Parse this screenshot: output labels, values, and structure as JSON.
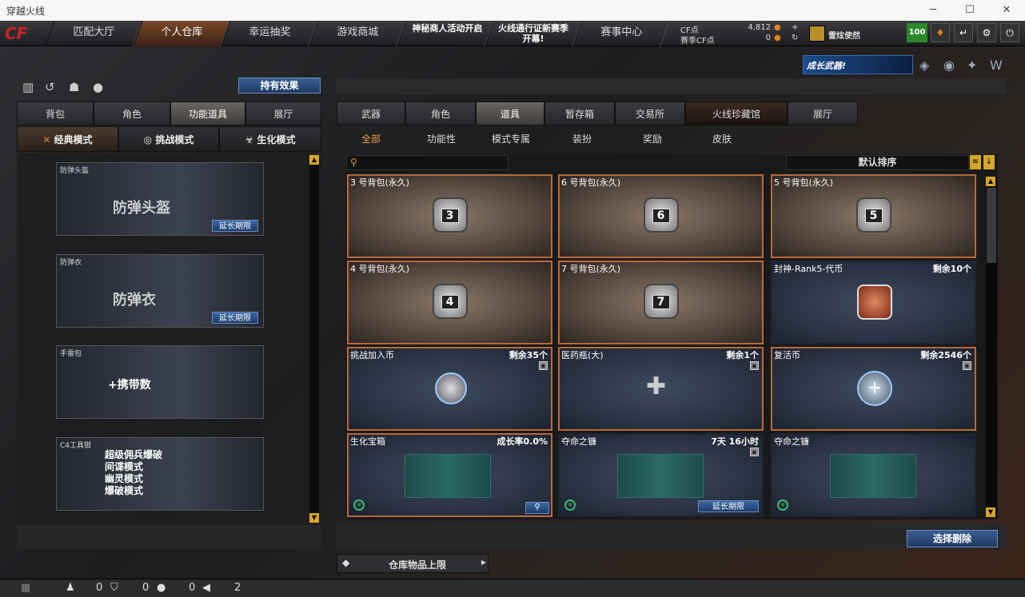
{
  "window": {
    "title": "穿越火线",
    "min": "─",
    "max": "☐",
    "close": "✕"
  },
  "nav": {
    "tabs": [
      "匹配大厅",
      "个人仓库",
      "幸运抽奖",
      "游戏商城",
      "神秘商人活动开启",
      "火线通行证新赛季开幕!",
      "赛事中心"
    ],
    "active": 1
  },
  "currency": {
    "cf_label": "CF点",
    "cf_value": "4,812",
    "scf_label": "赛季CF点",
    "scf_value": "0",
    "user": "雷炫使然",
    "level": "100"
  },
  "banner": {
    "text": "成长武器!"
  },
  "left": {
    "effect_button": "持有效果",
    "tabs": [
      "背包",
      "角色",
      "功能道具",
      "展厅"
    ],
    "active_tab": 2,
    "modes": [
      "经典模式",
      "挑战模式",
      "生化模式"
    ],
    "active_mode": 0,
    "items": [
      {
        "label": "防弹头盔",
        "big": "防弹头盔",
        "ext": "延长期限"
      },
      {
        "label": "防弹衣",
        "big": "防弹衣",
        "ext": "延长期限"
      },
      {
        "label": "手雷包",
        "big": "+携带数"
      },
      {
        "label": "C4工具钳",
        "lines": [
          "超级佣兵爆破",
          "间谍模式",
          "幽灵模式",
          "爆破模式"
        ]
      }
    ]
  },
  "right": {
    "tabs": [
      "武器",
      "角色",
      "道具",
      "暂存箱",
      "交易所",
      "火线珍藏馆",
      "展厅"
    ],
    "active_tab": 2,
    "subtabs": [
      "全部",
      "功能性",
      "模式专属",
      "装扮",
      "奖励",
      "皮肤"
    ],
    "search_placeholder": "",
    "sort": "默认排序",
    "items": [
      {
        "name": "3 号背包(永久)",
        "bag": "3"
      },
      {
        "name": "6 号背包(永久)",
        "bag": "6"
      },
      {
        "name": "5 号背包(永久)",
        "bag": "5"
      },
      {
        "name": "4 号背包(永久)",
        "bag": "4"
      },
      {
        "name": "7 号背包(永久)",
        "bag": "7"
      },
      {
        "name": "封神-Rank5-代币",
        "right": "剩余10个"
      },
      {
        "name": "挑战加入币",
        "right": "剩余35个"
      },
      {
        "name": "医药瓶(大)",
        "right": "剩余1个"
      },
      {
        "name": "复活币",
        "right": "剩余2546个"
      },
      {
        "name": "生化宝箱",
        "right": "成长率0.0%"
      },
      {
        "name": "夺命之镰",
        "right": "7天 16小时",
        "ext": "延长期限"
      },
      {
        "name": "夺命之镰",
        "right": ""
      }
    ],
    "delete_button": "选择删除",
    "storage_button": "仓库物品上限"
  },
  "status": {
    "v1": "0",
    "v2": "0",
    "v3": "0",
    "v4": "2"
  }
}
